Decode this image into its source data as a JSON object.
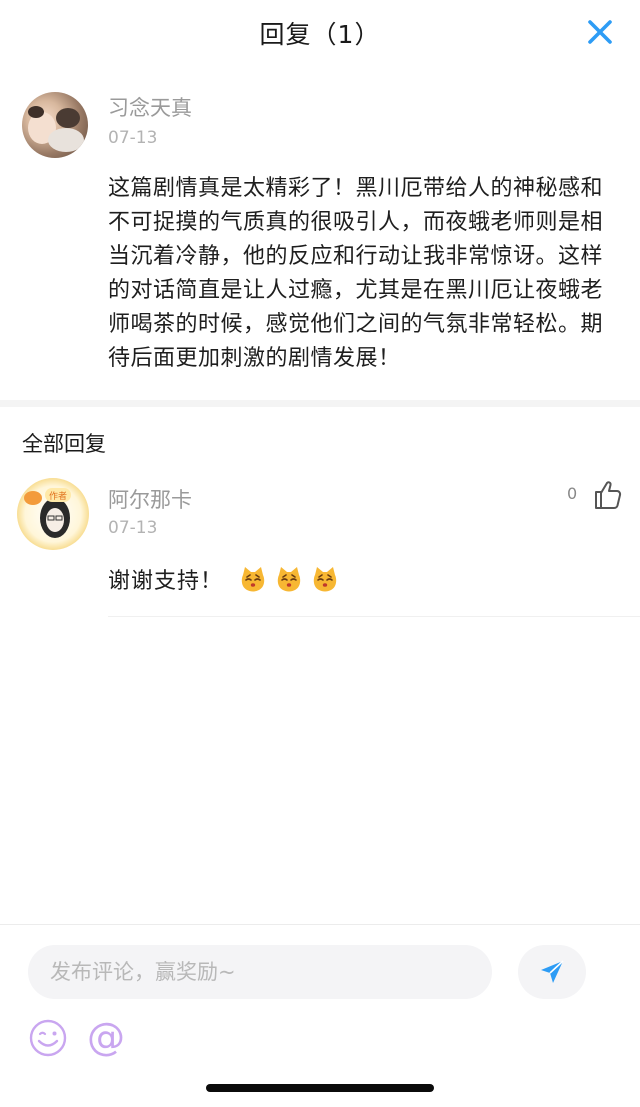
{
  "header": {
    "title": "回复（1）"
  },
  "main_comment": {
    "username": "习念天真",
    "date": "07-13",
    "text": "这篇剧情真是太精彩了！黑川厄带给人的神秘感和不可捉摸的气质真的很吸引人，而夜蛾老师则是相当沉着冷静，他的反应和行动让我非常惊讶。这样的对话简直是让人过瘾，尤其是在黑川厄让夜蛾老师喝茶的时候，感觉他们之间的气氛非常轻松。期待后面更加刺激的剧情发展！"
  },
  "replies_section": {
    "title": "全部回复"
  },
  "replies": [
    {
      "username": "阿尔那卡",
      "date": "07-13",
      "like_count": "0",
      "text": "谢谢支持！",
      "badge": "作者"
    }
  ],
  "input": {
    "placeholder": "发布评论，赢奖励~"
  },
  "icons": {
    "close": "close-icon",
    "like": "thumbs-up-icon",
    "send": "send-icon",
    "emoji": "smile-icon",
    "at": "@"
  },
  "colors": {
    "accent_blue": "#2d9cf5",
    "emoji_purple": "#c9a6f0"
  }
}
